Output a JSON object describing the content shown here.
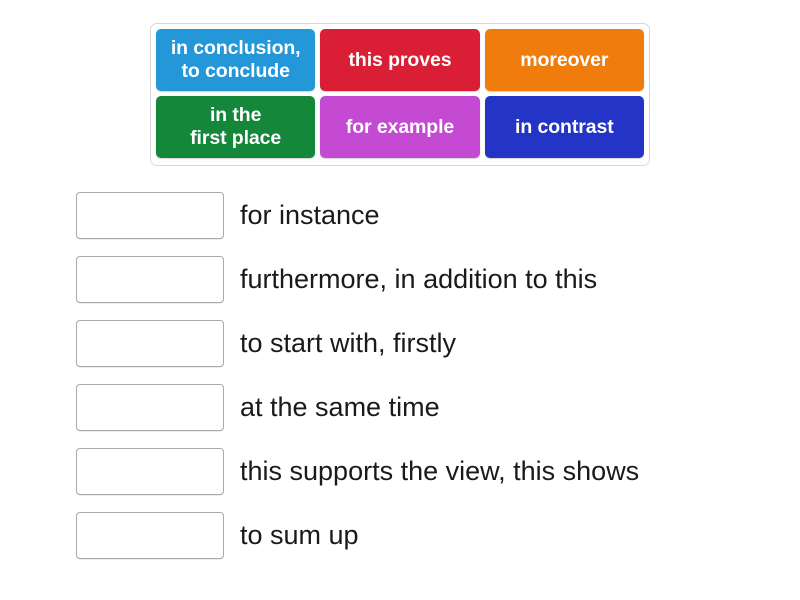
{
  "activity": {
    "type": "match-up",
    "tray": {
      "tiles": [
        {
          "label": "in conclusion,\nto conclude",
          "color": "#2397d8"
        },
        {
          "label": "this proves",
          "color": "#da1e35"
        },
        {
          "label": "moreover",
          "color": "#f07c0e"
        },
        {
          "label": "in the\nfirst place",
          "color": "#15873b"
        },
        {
          "label": "for example",
          "color": "#c44ad4"
        },
        {
          "label": "in contrast",
          "color": "#2334c6"
        }
      ]
    },
    "rows": [
      {
        "drop_value": "",
        "prompt": "for instance"
      },
      {
        "drop_value": "",
        "prompt": "furthermore, in addition to this"
      },
      {
        "drop_value": "",
        "prompt": "to start with, firstly"
      },
      {
        "drop_value": "",
        "prompt": "at the same time"
      },
      {
        "drop_value": "",
        "prompt": "this supports the view, this shows"
      },
      {
        "drop_value": "",
        "prompt": "to sum up"
      }
    ]
  },
  "colors": {
    "page_background": "#ffffff",
    "tray_border": "#d9d9d9",
    "dropzone_border": "#a9a9a9",
    "prompt_text": "#1a1a1a",
    "tile_text": "#ffffff"
  }
}
